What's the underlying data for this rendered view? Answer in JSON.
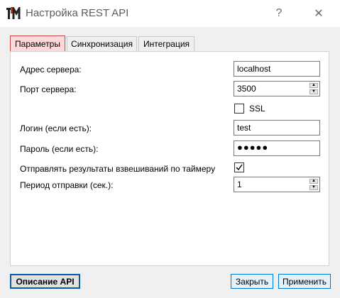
{
  "window": {
    "title": "Настройка REST API",
    "help_glyph": "?",
    "close_glyph": "✕",
    "icon": "app-logo-tm-icon"
  },
  "tabs": [
    {
      "label": "Параметры",
      "active": true
    },
    {
      "label": "Синхронизация",
      "active": false
    },
    {
      "label": "Интеграция",
      "active": false
    }
  ],
  "form": {
    "server_address": {
      "label": "Адрес сервера:",
      "value": "localhost"
    },
    "server_port": {
      "label": "Порт сервера:",
      "value": "3500"
    },
    "ssl": {
      "label": "SSL",
      "checked": false
    },
    "login": {
      "label": "Логин (если есть):",
      "value": "test"
    },
    "password": {
      "label": "Пароль (если есть):",
      "value": "●●●●●"
    },
    "timer_send": {
      "label": "Отправлять результаты взвешиваний по таймеру",
      "checked": true
    },
    "send_period": {
      "label": "Период отправки (сек.):",
      "value": "1"
    }
  },
  "buttons": {
    "api_description": "Описание API",
    "close": "Закрыть",
    "apply": "Применить"
  },
  "colors": {
    "active_tab_bg": "#ffd9d9",
    "active_tab_border": "#c14a4a",
    "button_focus": "#0078d7"
  }
}
